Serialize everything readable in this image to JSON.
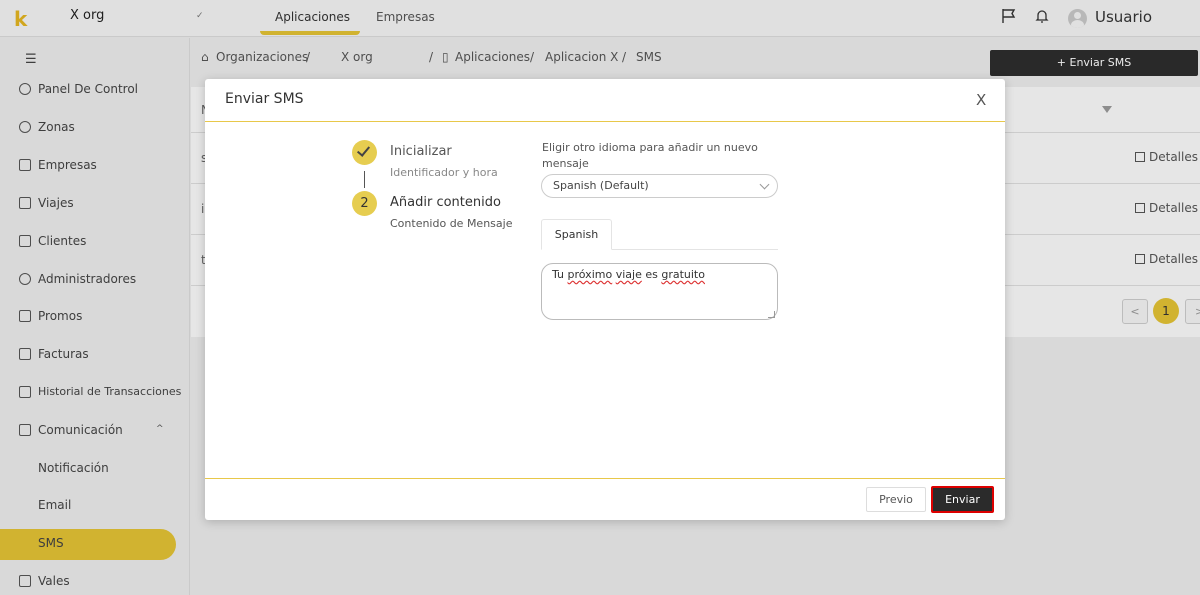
{
  "topbar": {
    "logo": "k",
    "org_name": "X org",
    "tabs": [
      {
        "label": "Aplicaciones"
      },
      {
        "label": "Empresas"
      }
    ],
    "username": "Usuario"
  },
  "sidebar": {
    "items": [
      {
        "label": "Panel De Control"
      },
      {
        "label": "Zonas"
      },
      {
        "label": "Empresas"
      },
      {
        "label": "Viajes"
      },
      {
        "label": "Clientes"
      },
      {
        "label": "Administradores"
      },
      {
        "label": "Promos"
      },
      {
        "label": "Facturas"
      },
      {
        "label": "Historial de Transacciones"
      },
      {
        "label": "Comunicación"
      },
      {
        "label": "Notificación"
      },
      {
        "label": "Email"
      },
      {
        "label": "SMS"
      },
      {
        "label": "Vales"
      }
    ]
  },
  "breadcrumb": {
    "organizaciones": "Organizaciones",
    "org": "X org",
    "aplicaciones": "Aplicaciones",
    "app": "Aplicacion X",
    "current": "SMS",
    "sep": "/"
  },
  "page": {
    "send_button": "Enviar SMS",
    "header_letter": "N",
    "rows": [
      {
        "letter": "s",
        "action": "Detalles"
      },
      {
        "letter": "i",
        "action": "Detalles"
      },
      {
        "letter": "t",
        "action": "Detalles"
      }
    ],
    "pagination": {
      "current": "1"
    }
  },
  "modal": {
    "title": "Enviar SMS",
    "close": "X",
    "steps": [
      {
        "number": "1",
        "title": "Inicializar",
        "subtitle": "Identificador y hora",
        "state": "done"
      },
      {
        "number": "2",
        "title": "Añadir contenido",
        "subtitle": "Contenido de Mensaje",
        "state": "active"
      }
    ],
    "language_label": "Eligir otro idioma para añadir un nuevo mensaje",
    "language_selected": "Spanish (Default)",
    "language_tab": "Spanish",
    "message": {
      "w1": "Tu ",
      "w2": "próximo",
      "w3": " ",
      "w4": "viaje",
      "w5": " es ",
      "w6": "gratuito"
    },
    "prev_button": "Previo",
    "submit_button": "Enviar"
  },
  "colors": {
    "accent": "#e3c335",
    "dark_button": "#2b2b2b",
    "highlight_border": "#dd0000"
  }
}
